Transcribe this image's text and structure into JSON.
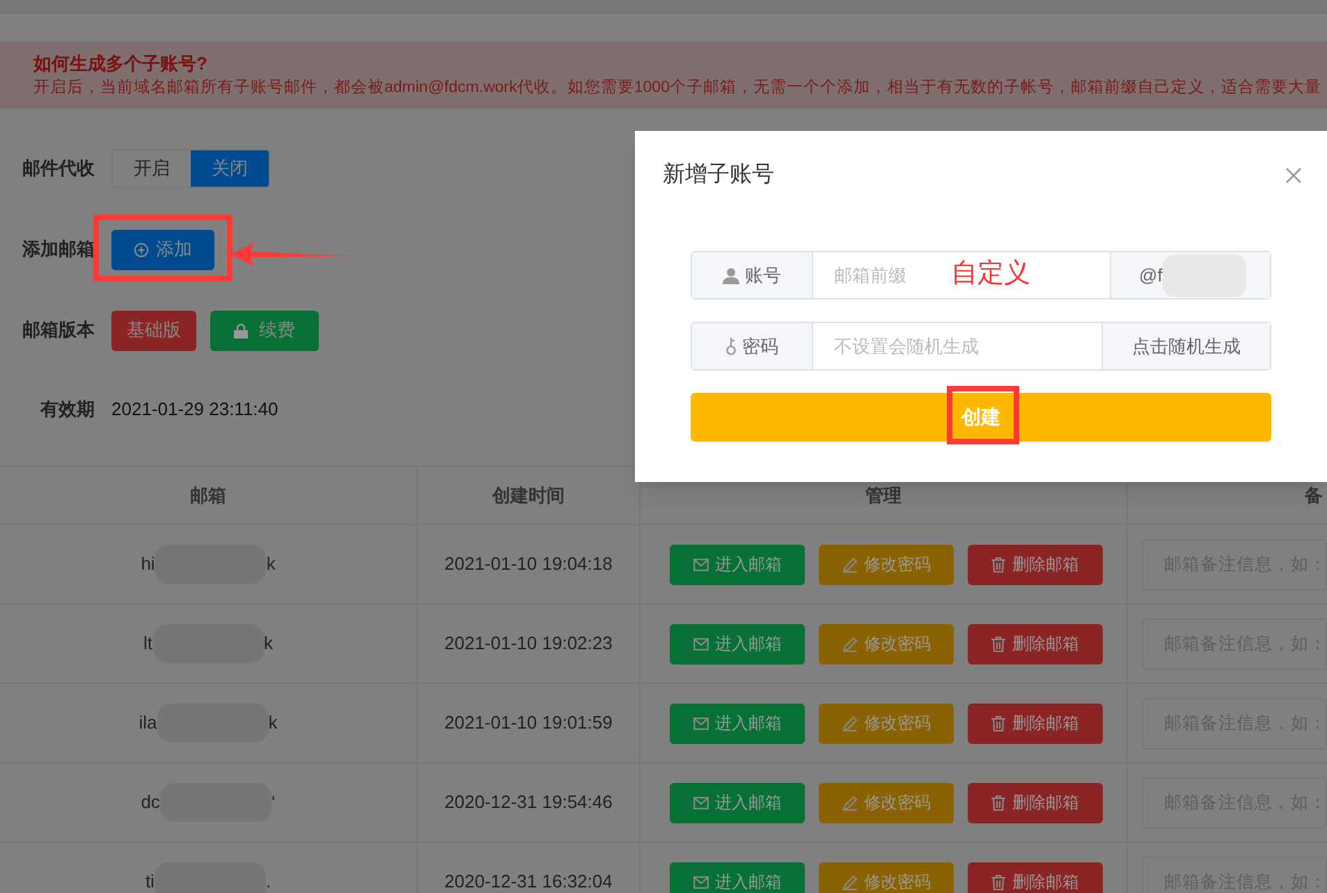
{
  "notice": {
    "title": "如何生成多个子账号?",
    "text": "开启后，当前域名邮箱所有子账号邮件，都会被admin@fdcm.work代收。如您需要1000个子邮箱，无需一个个添加，相当于有无数的子帐号，邮箱前缀自己定义，适合需要大量"
  },
  "form": [
    {
      "kind": "toggle",
      "label": "邮件代收",
      "options": [
        {
          "label": "开启",
          "selected": false
        },
        {
          "label": "关闭",
          "selected": true
        }
      ]
    },
    {
      "kind": "add",
      "label": "添加邮箱",
      "button": "添加"
    },
    {
      "kind": "version",
      "label": "邮箱版本",
      "buttons": [
        {
          "kind": "tag",
          "label": "基础版"
        },
        {
          "kind": "renew",
          "label": "续费"
        }
      ]
    },
    {
      "kind": "date",
      "label": "有效期",
      "value": "2021-01-29 23:11:40"
    }
  ],
  "table": {
    "columns": [
      "邮箱",
      "创建时间",
      "管理",
      "备"
    ],
    "rows": [
      {
        "email_start": "hi",
        "email_end": "k",
        "created": "2021-01-10 19:04:18",
        "actions": [
          "进入邮箱",
          "修改密码",
          "删除邮箱"
        ],
        "note_placeholder": "邮箱备注信息，如："
      },
      {
        "email_start": "lt",
        "email_end": "k",
        "created": "2021-01-10 19:02:23",
        "actions": [
          "进入邮箱",
          "修改密码",
          "删除邮箱"
        ],
        "note_placeholder": "邮箱备注信息，如："
      },
      {
        "email_start": "ila",
        "email_end": "k",
        "created": "2021-01-10 19:01:59",
        "actions": [
          "进入邮箱",
          "修改密码",
          "删除邮箱"
        ],
        "note_placeholder": "邮箱备注信息，如："
      },
      {
        "email_start": "dc",
        "email_end": "‘",
        "created": "2020-12-31 19:54:46",
        "actions": [
          "进入邮箱",
          "修改密码",
          "删除邮箱"
        ],
        "note_placeholder": "邮箱备注信息，如："
      },
      {
        "email_start": "ti",
        "email_end": ".",
        "created": "2020-12-31 16:32:04",
        "actions": [
          "进入邮箱",
          "修改密码",
          "删除邮箱"
        ],
        "note_placeholder": "邮箱备注信息，如："
      }
    ]
  },
  "modal": {
    "title": "新增子账号",
    "account": {
      "label": "账号",
      "placeholder": "邮箱前缀",
      "suffix": "@f"
    },
    "password": {
      "label": "密码",
      "placeholder": "不设置会随机生成",
      "button": "点击随机生成"
    },
    "submit": "创建"
  },
  "annotations": {
    "custom_label": "自定义"
  }
}
